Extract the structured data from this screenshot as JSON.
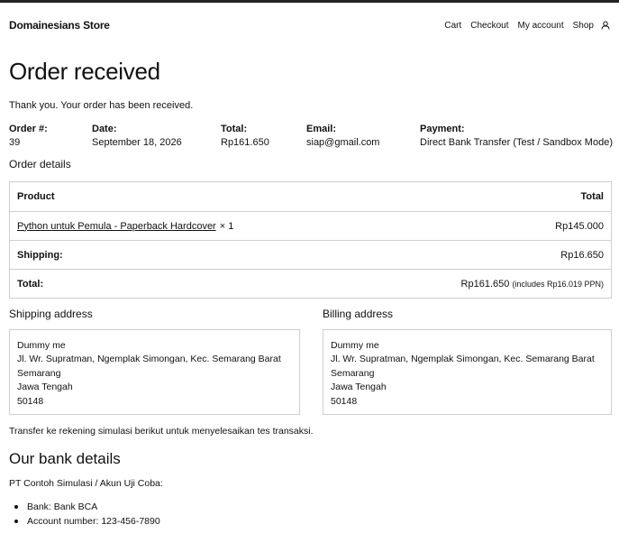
{
  "header": {
    "site_title": "Domainesians Store",
    "nav": [
      "Cart",
      "Checkout",
      "My account",
      "Shop"
    ],
    "account_icon": "user-icon"
  },
  "page": {
    "title": "Order received",
    "thankyou": "Thank you. Your order has been received."
  },
  "overview": {
    "order_number": {
      "label": "Order #:",
      "value": "39"
    },
    "date": {
      "label": "Date:",
      "value": "September 18, 2026"
    },
    "total": {
      "label": "Total:",
      "value": "Rp161.650"
    },
    "email": {
      "label": "Email:",
      "value": "siap@gmail.com"
    },
    "payment": {
      "label": "Payment:",
      "value": "Direct Bank Transfer (Test / Sandbox Mode)"
    }
  },
  "order_details": {
    "heading": "Order details",
    "header": {
      "product": "Product",
      "total": "Total"
    },
    "items": [
      {
        "name": "Python untuk Pemula - Paperback Hardcover",
        "qty": "× 1",
        "total": "Rp145.000"
      }
    ],
    "shipping": {
      "label": "Shipping:",
      "value": "Rp16.650"
    },
    "total": {
      "label": "Total:",
      "value": "Rp161.650",
      "note": "(includes Rp16.019 PPN)"
    }
  },
  "shipping_address": {
    "heading": "Shipping address",
    "lines": [
      "Dummy me",
      "Jl. Wr. Supratman, Ngemplak Simongan, Kec. Semarang Barat",
      "Semarang",
      "Jawa Tengah",
      "50148"
    ]
  },
  "billing_address": {
    "heading": "Billing address",
    "lines": [
      "Dummy me",
      "Jl. Wr. Supratman, Ngemplak Simongan, Kec. Semarang Barat",
      "Semarang",
      "Jawa Tengah",
      "50148"
    ]
  },
  "bank": {
    "transfer_note": "Transfer ke rekening simulasi berikut untuk menyelesaikan tes transaksi.",
    "title": "Our bank details",
    "account_name": "PT Contoh Simulasi / Akun Uji Coba:",
    "items": [
      {
        "label": "Bank:",
        "value": "Bank BCA"
      },
      {
        "label": "Account number:",
        "value": "123-456-7890"
      }
    ]
  }
}
